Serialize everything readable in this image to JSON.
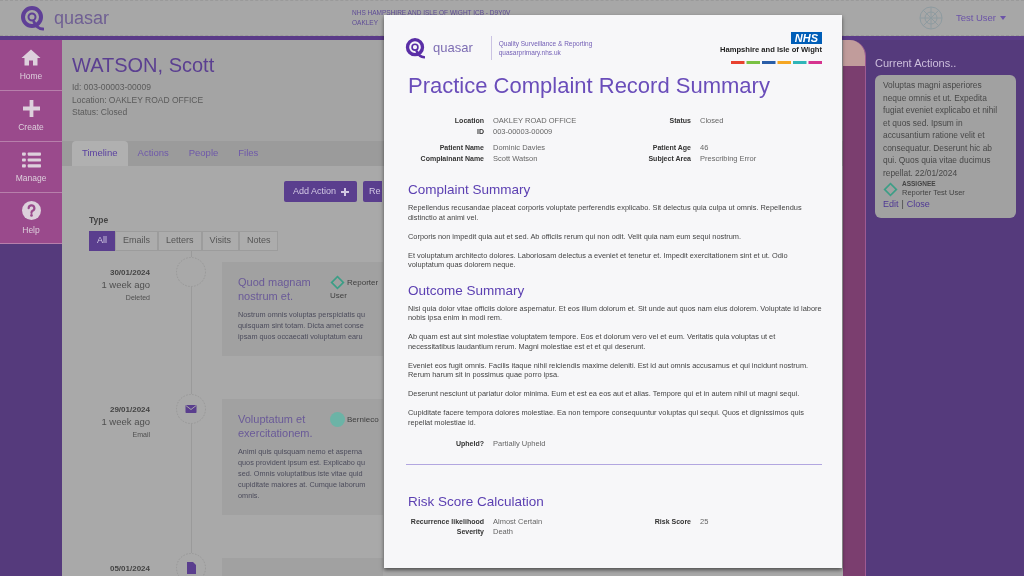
{
  "top_bar": {
    "app_name": "quasar",
    "organisation": "NHS HAMPSHIRE AND ISLE OF WIGHT ICB - D9Y0V",
    "location": "OAKLEY",
    "user": "Test User"
  },
  "sidebar": {
    "items": [
      {
        "label": "Home"
      },
      {
        "label": "Create"
      },
      {
        "label": "Manage"
      },
      {
        "label": "Help"
      }
    ]
  },
  "record": {
    "title": "WATSON, Scott",
    "meta": [
      "Id: 003-00003-00009",
      "Location: OAKLEY ROAD OFFICE",
      "Status: Closed"
    ]
  },
  "tabs": [
    {
      "label": "Timeline",
      "selected": true
    },
    {
      "label": "Actions",
      "selected": false
    },
    {
      "label": "People",
      "selected": false
    },
    {
      "label": "Files",
      "selected": false
    }
  ],
  "action_buttons": [
    {
      "label": "Add Action",
      "kind": "add"
    },
    {
      "label": "Re",
      "kind": "plain"
    }
  ],
  "type_filter": {
    "label": "Type",
    "options": [
      {
        "label": "All",
        "selected": true
      },
      {
        "label": "Emails",
        "selected": false
      },
      {
        "label": "Letters",
        "selected": false
      },
      {
        "label": "Visits",
        "selected": false
      },
      {
        "label": "Notes",
        "selected": false
      }
    ]
  },
  "timeline": [
    {
      "date": "30/01/2024",
      "ago": "1 week ago",
      "kind": "deleted",
      "kind_label": "Deleted",
      "title": "Quod magnam nostrum et.",
      "person_lines": [
        "Reporter",
        "User"
      ],
      "body_lines": [
        "Nostrum omnis voluptas perspiciatis qu",
        "quisquam sint totam. Dicta amet conse",
        "ipsam quos occaecati voluptatum earu"
      ]
    },
    {
      "date": "29/01/2024",
      "ago": "1 week ago",
      "kind": "email",
      "kind_label": "Email",
      "title": "Voluptatum et exercitationem.",
      "person_lines": [
        "Bernieco"
      ],
      "body_lines": [
        "Animi quis quisquam nemo et asperna",
        "quos provident ipsum est. Explicabo qu",
        "sed. Omnis voluptatibus iste vitae quid",
        "cupiditate maiores at. Cumque laborum",
        "omnis."
      ]
    },
    {
      "date": "05/01/2024",
      "kind": "file"
    }
  ],
  "current_actions": {
    "heading": "Current Actions..",
    "items": [
      {
        "text": "Voluptas magni asperiores neque omnis et ut. Expedita fugiat eveniet explicabo et nihil et quos sed. Ipsum in accusantium ratione velit et consequatur. Deserunt hic ab qui. Quos quia vitae ducimus repellat. 22/01/2024",
        "assignee_label": "ASSIGNEE",
        "assignee": "Reporter Test User",
        "links": [
          "Edit",
          "Close"
        ],
        "separator": "|"
      }
    ]
  },
  "document": {
    "brand": {
      "name": "quasar",
      "tagline": "Quality Surveillance & Reporting",
      "website": "quasarprimary.nhs.uk"
    },
    "nhs": {
      "badge": "NHS",
      "organisation": "Hampshire and Isle of Wight"
    },
    "title": "Practice Complaint Record Summary",
    "details": [
      {
        "left": [
          {
            "label": "Location",
            "value": "OAKLEY ROAD OFFICE"
          },
          {
            "label": "ID",
            "value": "003-00003-00009"
          }
        ],
        "right": [
          {
            "label": "Status",
            "value": "Closed"
          }
        ]
      },
      {
        "left": [
          {
            "label": "Patient Name",
            "value": "Dominic Davies"
          },
          {
            "label": "Complainant Name",
            "value": "Scott Watson"
          }
        ],
        "right": [
          {
            "label": "Patient Age",
            "value": "46"
          },
          {
            "label": "Subject Area",
            "value": "Prescribing Error"
          }
        ]
      }
    ],
    "sections": [
      {
        "heading": "Complaint Summary",
        "paragraphs": [
          "Repellendus recusandae placeat corporis voluptate perferendis explicabo. Sit delectus quia culpa ut omnis. Repellendus distinctio at animi vel.",
          "Corporis non impedit quia aut et sed. Ab officiis rerum qui non odit. Velit quia nam eum sequi nostrum.",
          "Et voluptatum architecto dolores. Laboriosam delectus a eveniet et tenetur et. Impedit exercitationem sint et ut. Odio voluptatum quas dolorem neque."
        ]
      },
      {
        "heading": "Outcome Summary",
        "paragraphs": [
          "Nisi quia dolor vitae officiis dolore aspernatur. Et eos illum dolorum et. Sit unde aut quos nam eius dolorem. Voluptate id labore nobis ipsa enim in modi rem.",
          "Ab quam est aut sint molestiae voluptatem tempore. Eos et dolorum vero vel et eum. Veritatis quia voluptas ut et necessitatibus laudantium rerum. Magni molestiae est et et qui deserunt.",
          "Eveniet eos fugit omnis. Facilis itaque nihil reiciendis maxime deleniti. Est id aut omnis accusamus et qui incidunt nostrum. Rerum harum sit in possimus quae porro ipsa.",
          "Deserunt nesciunt ut pariatur dolor minima. Eum et est ea eos aut et alias. Tempore qui et in autem nihil ut magni sequi.",
          "Cupiditate facere tempora dolores molestiae. Ea non tempore consequuntur voluptas qui sequi. Quos et dignissimos quis repellat molestiae id."
        ],
        "details": [
          {
            "left": [
              {
                "label": "Upheld?",
                "value": "Partially Upheld"
              }
            ]
          }
        ]
      }
    ],
    "risk": {
      "heading": "Risk Score Calculation",
      "details": [
        {
          "left": [
            {
              "label": "Recurrence likelihood",
              "value": "Almost Certain"
            },
            {
              "label": "Severity",
              "value": "Death"
            }
          ],
          "right": [
            {
              "label": "Risk Score",
              "value": "25"
            }
          ]
        }
      ]
    }
  }
}
